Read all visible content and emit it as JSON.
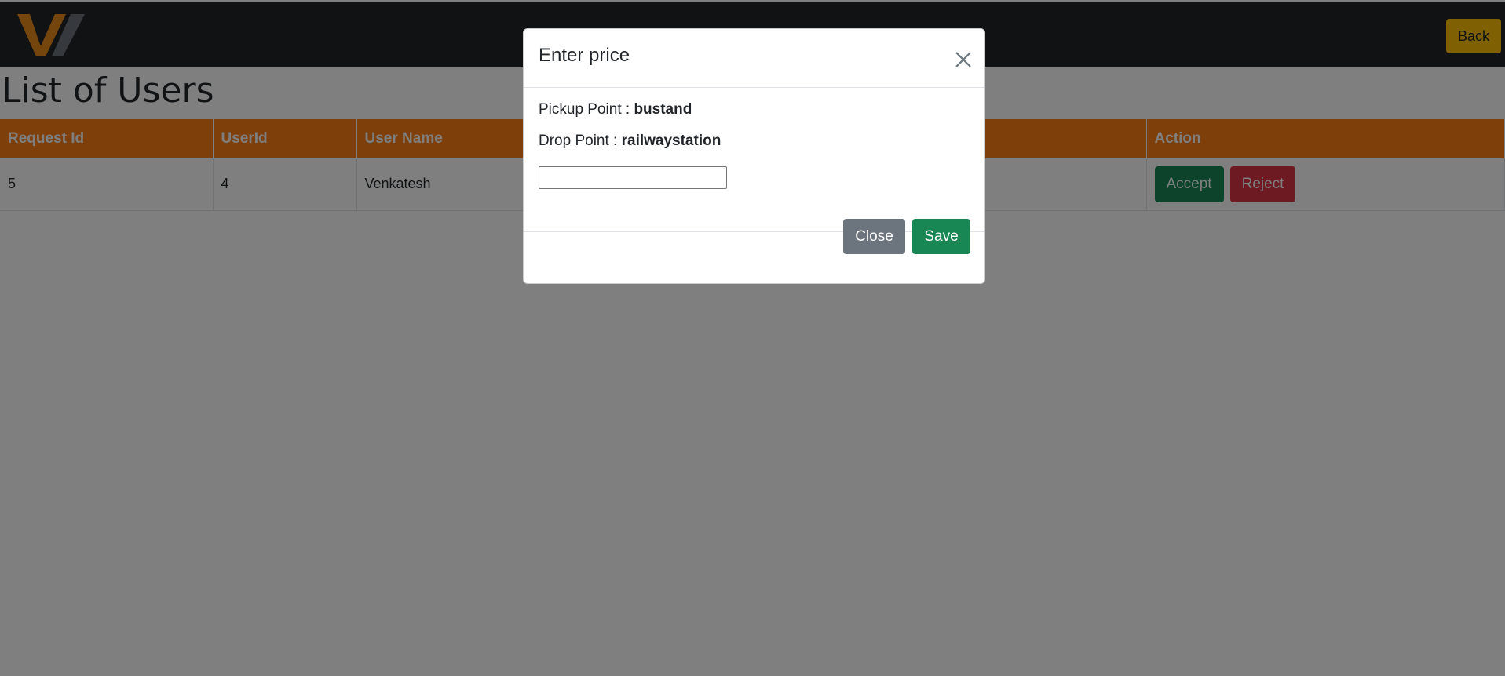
{
  "header": {
    "logo_icon": "brand-logo-icon",
    "back_label": "Back"
  },
  "page": {
    "title": "List of Users"
  },
  "table": {
    "columns": [
      "Request Id",
      "UserId",
      "User Name",
      "",
      "",
      "Action"
    ],
    "rows": [
      {
        "request_id": "5",
        "user_id": "4",
        "user_name": "Venkatesh",
        "col4": "",
        "col5": "",
        "accept_label": "Accept",
        "reject_label": "Reject"
      }
    ]
  },
  "modal": {
    "title": "Enter price",
    "close_icon": "close-icon",
    "pickup_label": "Pickup Point :",
    "pickup_value": "bustand",
    "drop_label": "Drop Point :",
    "drop_value": "railwaystation",
    "price_value": "",
    "close_label": "Close",
    "save_label": "Save"
  },
  "colors": {
    "topbar": "#212529",
    "table_header": "#fd7e14",
    "back_button": "#ffc107",
    "accept": "#198754",
    "reject": "#dc3545",
    "close_button": "#6c757d",
    "save_button": "#198754"
  }
}
